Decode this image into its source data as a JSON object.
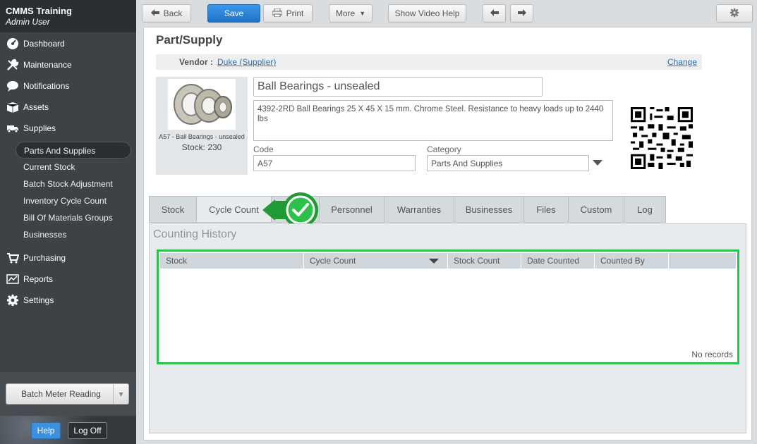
{
  "app": {
    "title": "CMMS Training",
    "user": "Admin User"
  },
  "sidebar": {
    "items": [
      {
        "label": "Dashboard",
        "icon": "dashboard-icon"
      },
      {
        "label": "Maintenance",
        "icon": "wrench-icon"
      },
      {
        "label": "Notifications",
        "icon": "chat-bubble-icon"
      },
      {
        "label": "Assets",
        "icon": "boxes-icon"
      },
      {
        "label": "Supplies",
        "icon": "truck-icon"
      }
    ],
    "sub_items": [
      {
        "label": "Parts And Supplies",
        "active": true
      },
      {
        "label": "Current Stock"
      },
      {
        "label": "Batch Stock Adjustment"
      },
      {
        "label": "Inventory Cycle Count"
      },
      {
        "label": "Bill Of Materials Groups"
      },
      {
        "label": "Businesses"
      }
    ],
    "items_after": [
      {
        "label": "Purchasing",
        "icon": "cart-icon"
      },
      {
        "label": "Reports",
        "icon": "chart-icon"
      },
      {
        "label": "Settings",
        "icon": "gear-icon"
      }
    ],
    "batch_button": "Batch Meter Reading",
    "help": "Help",
    "logoff": "Log Off"
  },
  "toolbar": {
    "back": "Back",
    "save": "Save",
    "print": "Print",
    "more": "More",
    "video_help": "Show Video Help"
  },
  "page": {
    "title": "Part/Supply",
    "vendor_label": "Vendor :",
    "vendor_value": "Duke (Supplier)",
    "change": "Change",
    "image_caption": "A57 - Ball Bearings - unsealed",
    "stock_text": "Stock: 230",
    "name": "Ball Bearings - unsealed",
    "description": "4392-2RD Ball Bearings 25 X 45 X 15 mm. Chrome Steel. Resistance to heavy loads up to 2440 lbs",
    "code_label": "Code",
    "code_value": "A57",
    "category_label": "Category",
    "category_value": "Parts And Supplies"
  },
  "tabs": [
    {
      "label": "Stock"
    },
    {
      "label": "Cycle Count",
      "active": true
    },
    {
      "label": "Personnel"
    },
    {
      "label": "Warranties"
    },
    {
      "label": "Businesses"
    },
    {
      "label": "Files"
    },
    {
      "label": "Custom"
    },
    {
      "label": "Log"
    }
  ],
  "history": {
    "title": "Counting History",
    "columns": [
      "Stock",
      "Cycle Count",
      "Stock Count",
      "Date Counted",
      "Counted By"
    ],
    "empty": "No records"
  },
  "colors": {
    "accent": "#1f73c9",
    "highlight": "#2dc04a",
    "sidebar": "#3d4247"
  }
}
